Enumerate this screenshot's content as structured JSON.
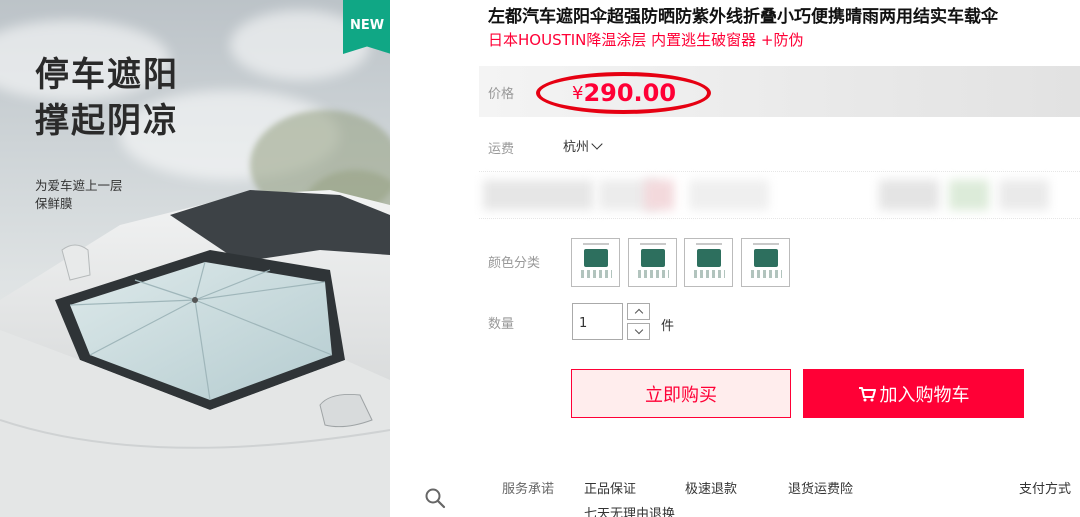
{
  "gallery": {
    "headline": [
      "停车遮阳",
      "撑起阴凉"
    ],
    "tagline": [
      "为爱车遮上一层",
      "保鲜膜"
    ],
    "badge": "NEW"
  },
  "product": {
    "title": "左都汽车遮阳伞超强防晒防紫外线折叠小巧便携晴雨两用结实车载伞",
    "subtitle": "日本HOUSTIN降温涂层 内置逃生破窗器 +防伪"
  },
  "price": {
    "label": "价格",
    "currency": "¥",
    "value": "290.00",
    "highlight_color": "#e60012"
  },
  "shipping": {
    "label": "运费",
    "city": "杭州"
  },
  "color": {
    "label": "颜色分类",
    "options_count": 4
  },
  "quantity": {
    "label": "数量",
    "value": "1",
    "unit": "件"
  },
  "actions": {
    "buy_now": "立即购买",
    "add_to_cart": "加入购物车"
  },
  "service": {
    "label": "服务承诺",
    "items": [
      "正品保证",
      "极速退款",
      "退货运费险"
    ],
    "pay_label": "支付方式",
    "more": "七天无理由退换"
  },
  "colors": {
    "brand_red": "#ff0036",
    "badge_green": "#10a785"
  }
}
